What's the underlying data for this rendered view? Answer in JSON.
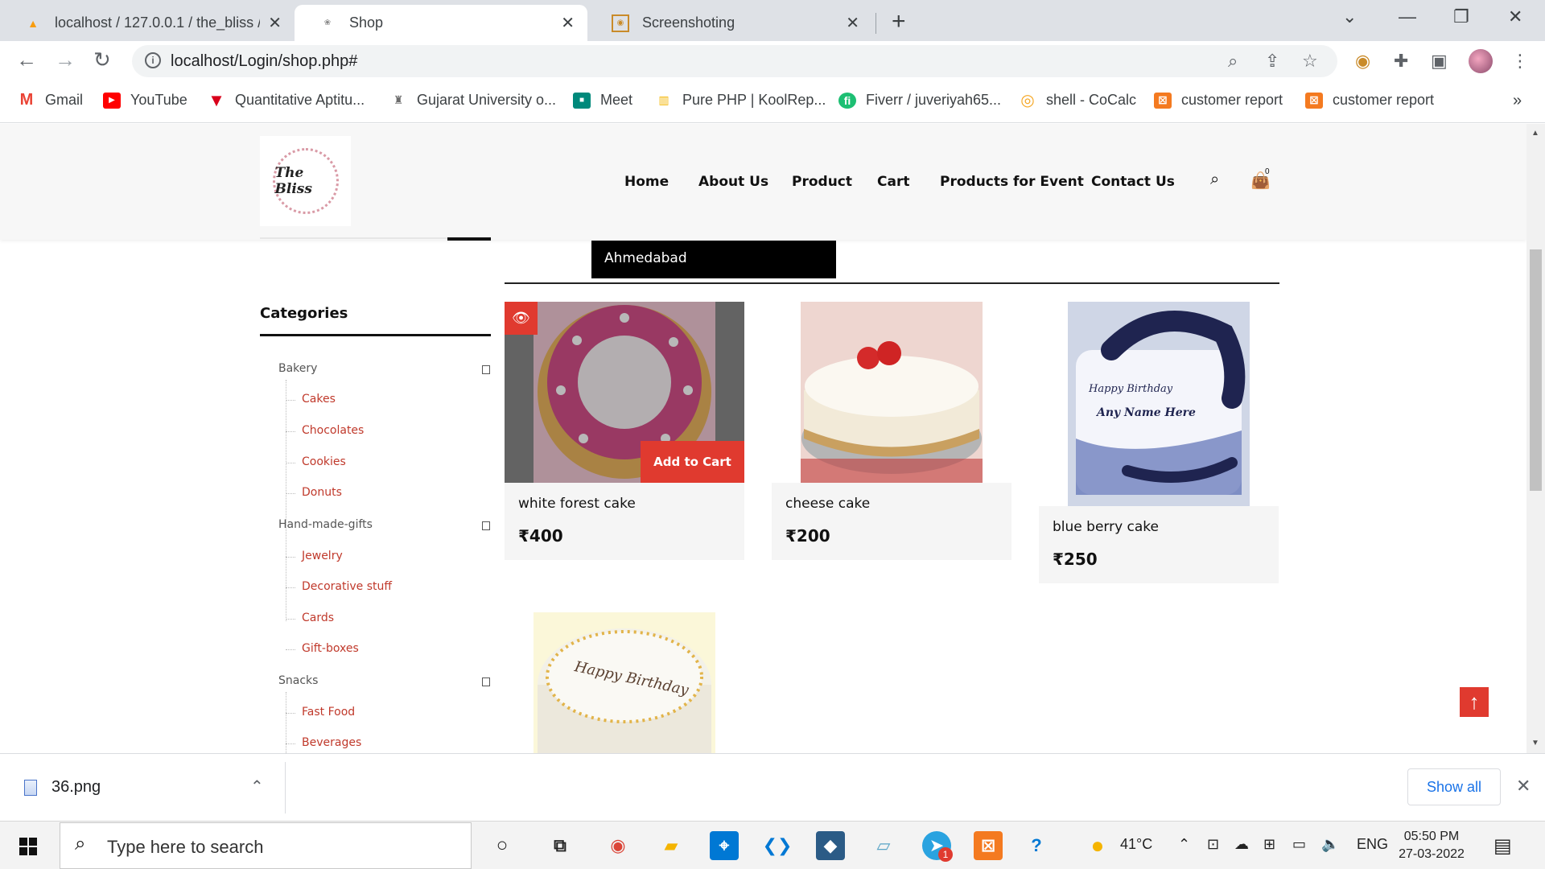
{
  "browser": {
    "tabs": [
      {
        "title": "localhost / 127.0.0.1 / the_bliss /",
        "icon": "phpmyadmin-icon"
      },
      {
        "title": "Shop",
        "icon": "site-icon"
      },
      {
        "title": "Screenshoting",
        "icon": "screenshot-icon"
      }
    ],
    "url": "localhost/Login/shop.php#",
    "bookmarks": [
      {
        "label": "Gmail",
        "icon": "gmail-icon",
        "color": "#ea4335"
      },
      {
        "label": "YouTube",
        "icon": "youtube-icon",
        "color": "#ff0000"
      },
      {
        "label": "Quantitative Aptitu...",
        "icon": "indiabix-icon",
        "color": "#d9001b"
      },
      {
        "label": "Gujarat University o...",
        "icon": "university-icon",
        "color": "#6b6b6b"
      },
      {
        "label": "Meet",
        "icon": "meet-icon",
        "color": "#00897b"
      },
      {
        "label": "Pure PHP | KoolRep...",
        "icon": "koolreport-icon",
        "color": "#f4b400"
      },
      {
        "label": "Fiverr / juveriyah65...",
        "icon": "fiverr-icon",
        "color": "#1dbf73"
      },
      {
        "label": "shell - CoCalc",
        "icon": "cocalc-icon",
        "color": "#f5a623"
      },
      {
        "label": "customer report",
        "icon": "xampp-icon",
        "color": "#f47a20"
      },
      {
        "label": "customer report",
        "icon": "xampp-icon",
        "color": "#f47a20"
      }
    ]
  },
  "site": {
    "logo_text": "The Bliss",
    "nav": [
      "Home",
      "About Us",
      "Product",
      "Cart",
      "Products for Event",
      "Contact Us"
    ],
    "cart_count": "0",
    "city": "Ahmedabad",
    "categories_title": "Categories",
    "categories": [
      {
        "name": "Bakery",
        "children": [
          "Cakes",
          "Chocolates",
          "Cookies",
          "Donuts"
        ]
      },
      {
        "name": "Hand-made-gifts",
        "children": [
          "Jewelry",
          "Decorative stuff",
          "Cards",
          "Gift-boxes"
        ]
      },
      {
        "name": "Snacks",
        "children": [
          "Fast Food",
          "Beverages"
        ]
      }
    ],
    "products": [
      {
        "name": "white forest cake",
        "price": "₹400"
      },
      {
        "name": "cheese cake",
        "price": "₹200"
      },
      {
        "name": "blue berry cake",
        "price": "₹250"
      }
    ],
    "add_to_cart_label": "Add to Cart",
    "blueberry_cake_text_1": "Happy Birthday",
    "blueberry_cake_text_2": "Any Name Here",
    "bday_cake_text": "Happy Birthday"
  },
  "downloads": {
    "file": "36.png",
    "show_all": "Show all"
  },
  "taskbar": {
    "search_placeholder": "Type here to search",
    "temperature": "41°C",
    "language": "ENG",
    "time": "05:50 PM",
    "date": "27-03-2022",
    "telegram_badge": "1"
  },
  "colors": {
    "accent_red": "#e03a2f",
    "category_link": "#c0392b",
    "chrome_tabbar": "#dee1e6"
  }
}
